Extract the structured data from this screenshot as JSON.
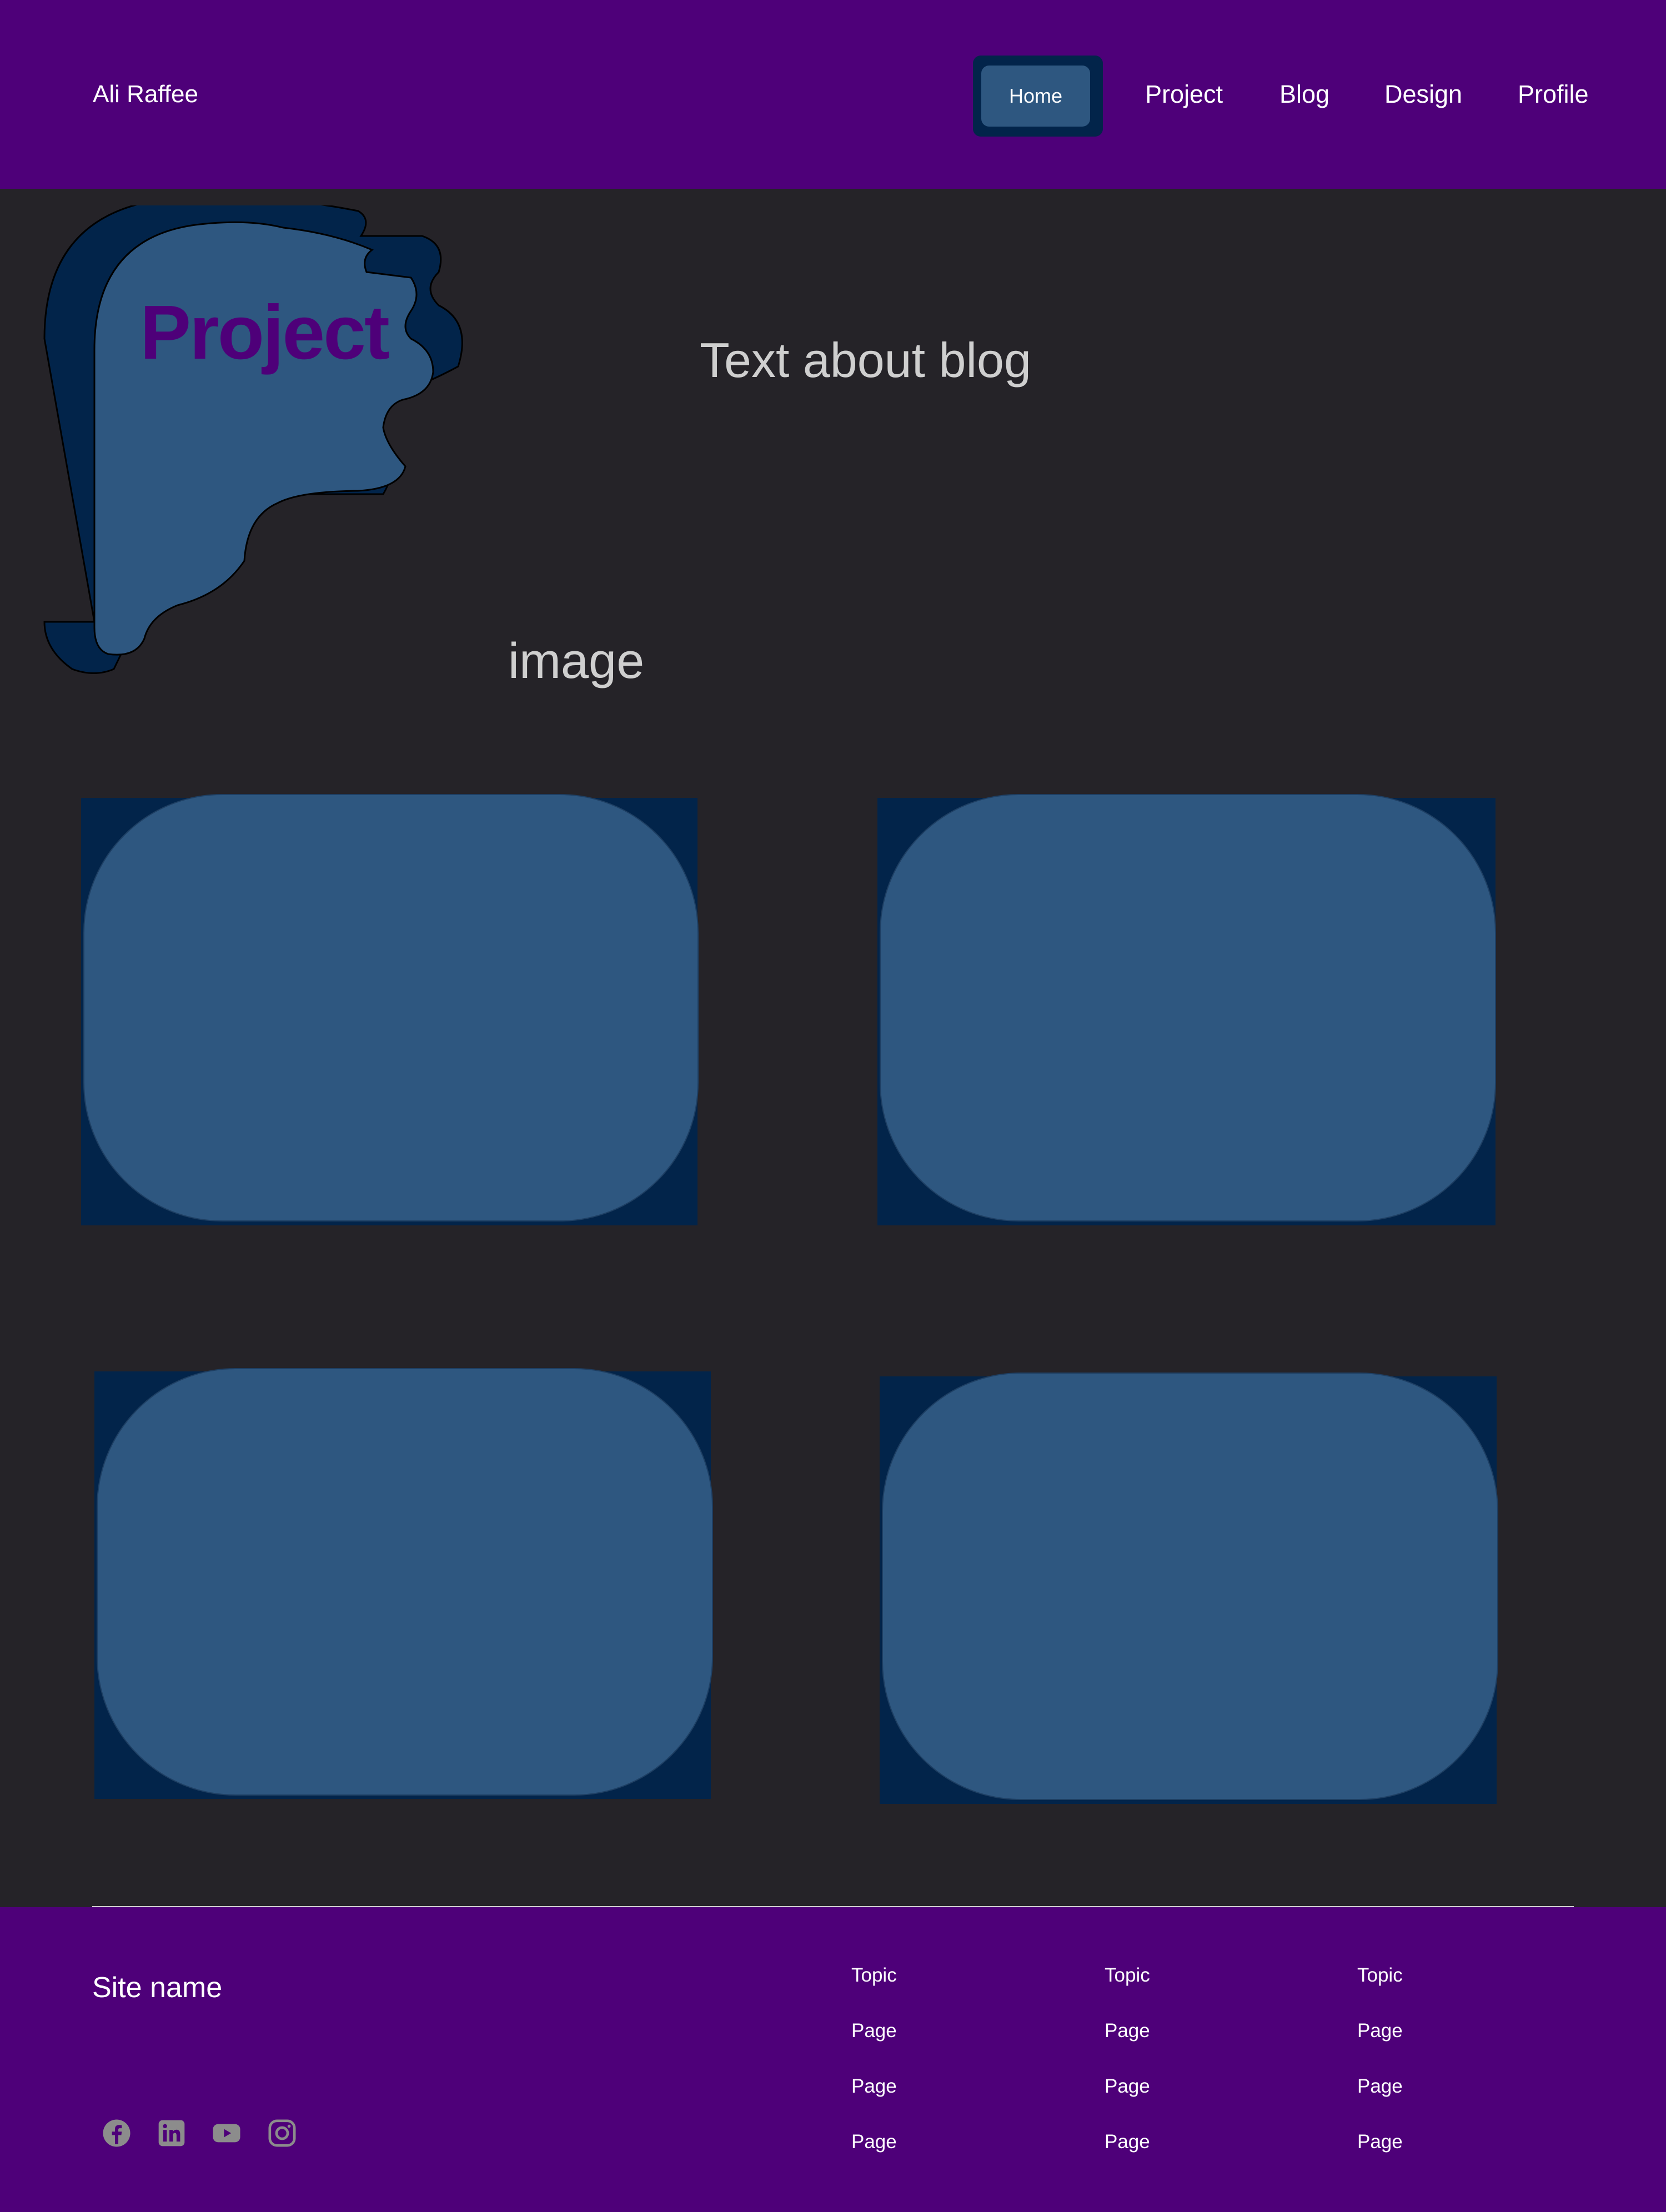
{
  "header": {
    "brand": "Ali Raffee",
    "nav": [
      {
        "label": "Home",
        "active": true
      },
      {
        "label": "Project"
      },
      {
        "label": "Blog"
      },
      {
        "label": "Design"
      },
      {
        "label": "Profile"
      }
    ]
  },
  "hero": {
    "title": "Project",
    "text": "Text about blog",
    "image_label": "image"
  },
  "cards": [
    {},
    {},
    {},
    {}
  ],
  "footer": {
    "site_name": "Site name",
    "social_icons": [
      "facebook-icon",
      "linkedin-icon",
      "youtube-icon",
      "instagram-icon"
    ],
    "columns": [
      {
        "topic": "Topic",
        "pages": [
          "Page",
          "Page",
          "Page"
        ]
      },
      {
        "topic": "Topic",
        "pages": [
          "Page",
          "Page",
          "Page"
        ]
      },
      {
        "topic": "Topic",
        "pages": [
          "Page",
          "Page",
          "Page"
        ]
      }
    ]
  },
  "colors": {
    "header_bg": "#4e0079",
    "page_bg": "#252328",
    "card_dark": "#02244a",
    "card_light": "#2e5780",
    "title_purple": "#4e0079",
    "muted_text": "#cfcfcf",
    "icon_gray": "#8c8c8c"
  }
}
